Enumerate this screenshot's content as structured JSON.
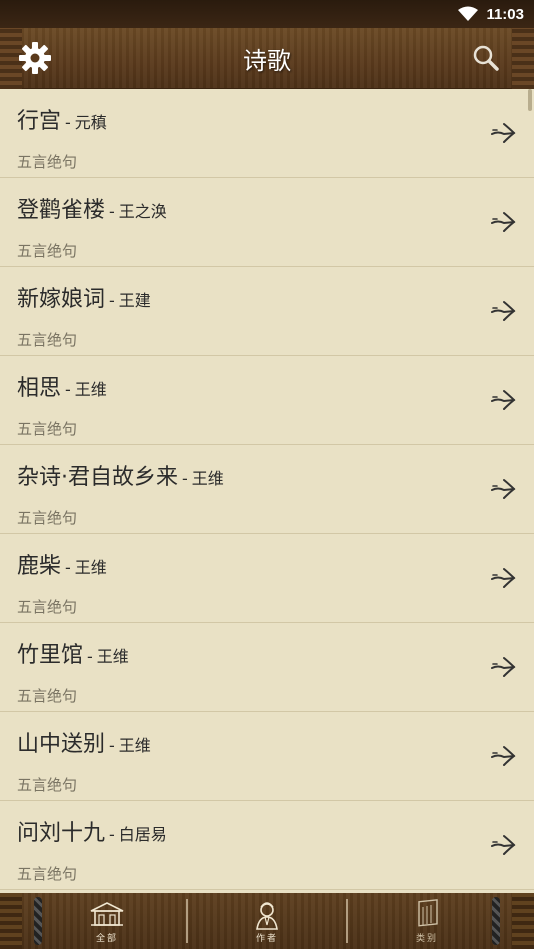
{
  "status": {
    "time": "11:03",
    "wifi_icon": "wifi-icon"
  },
  "header": {
    "title": "诗歌",
    "settings_icon": "gear-icon",
    "search_icon": "search-icon"
  },
  "poems": [
    {
      "title": "行宫",
      "author": "元稹",
      "category": "五言绝句"
    },
    {
      "title": "登鹳雀楼",
      "author": "王之涣",
      "category": "五言绝句"
    },
    {
      "title": "新嫁娘词",
      "author": "王建",
      "category": "五言绝句"
    },
    {
      "title": "相思",
      "author": "王维",
      "category": "五言绝句"
    },
    {
      "title": "杂诗·君自故乡来",
      "author": "王维",
      "category": "五言绝句"
    },
    {
      "title": "鹿柴",
      "author": "王维",
      "category": "五言绝句"
    },
    {
      "title": "竹里馆",
      "author": "王维",
      "category": "五言绝句"
    },
    {
      "title": "山中送别",
      "author": "王维",
      "category": "五言绝句"
    },
    {
      "title": "问刘十九",
      "author": "白居易",
      "category": "五言绝句"
    }
  ],
  "separator": "-",
  "tabs": [
    {
      "label": "全部",
      "icon": "building-icon"
    },
    {
      "label": "作者",
      "icon": "poet-portrait-icon"
    },
    {
      "label": "类别",
      "icon": "scroll-icon"
    }
  ],
  "colors": {
    "header_bg": "#5a3a1c",
    "list_bg": "#e9e1c5",
    "divider": "#d2c7a6"
  }
}
